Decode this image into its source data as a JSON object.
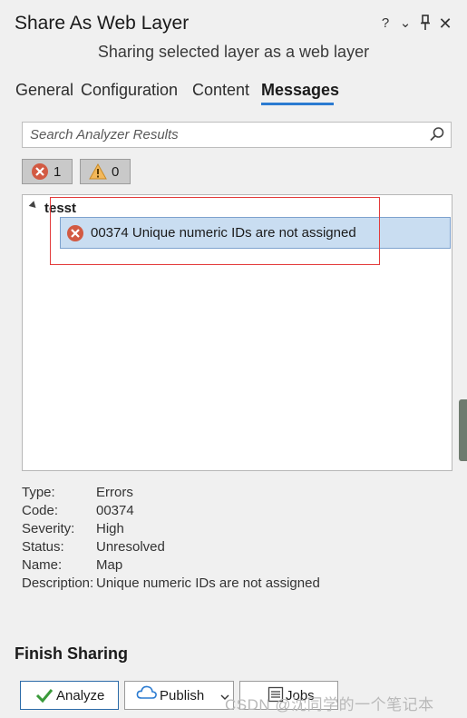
{
  "pane": {
    "title": "Share As Web Layer",
    "header_icons": {
      "help": "?",
      "options": "⌄",
      "pin": "pin-icon",
      "close": "✕"
    },
    "subtitle": "Sharing selected layer as a web layer"
  },
  "tabs": [
    {
      "label": "General"
    },
    {
      "label": "Configuration"
    },
    {
      "label": "Content"
    },
    {
      "label": "Messages",
      "selected": true
    }
  ],
  "search": {
    "placeholder": "Search Analyzer Results"
  },
  "filters": {
    "errors": {
      "count": "1"
    },
    "warnings": {
      "count": "0"
    }
  },
  "results": {
    "layer_name": "tesst",
    "items": [
      {
        "text": "00374 Unique numeric IDs are not assigned",
        "severity": "error"
      }
    ]
  },
  "details": [
    {
      "label": "Type:",
      "value": "Errors"
    },
    {
      "label": "Code:",
      "value": "00374"
    },
    {
      "label": "Severity:",
      "value": "High"
    },
    {
      "label": "Status:",
      "value": "Unresolved"
    },
    {
      "label": "Name:",
      "value": "Map"
    },
    {
      "label": "Description:",
      "value": "Unique numeric IDs are not assigned"
    }
  ],
  "finish": {
    "heading": "Finish Sharing",
    "analyze_label": "Analyze",
    "publish_label": "Publish",
    "jobs_label": "Jobs"
  },
  "watermark": "CSDN @沈同学的一个笔记本",
  "colors": {
    "accent": "#2b7bd1",
    "error": "#d9534f",
    "warning": "#f0ad4e",
    "selection": "#c9ddf1"
  }
}
